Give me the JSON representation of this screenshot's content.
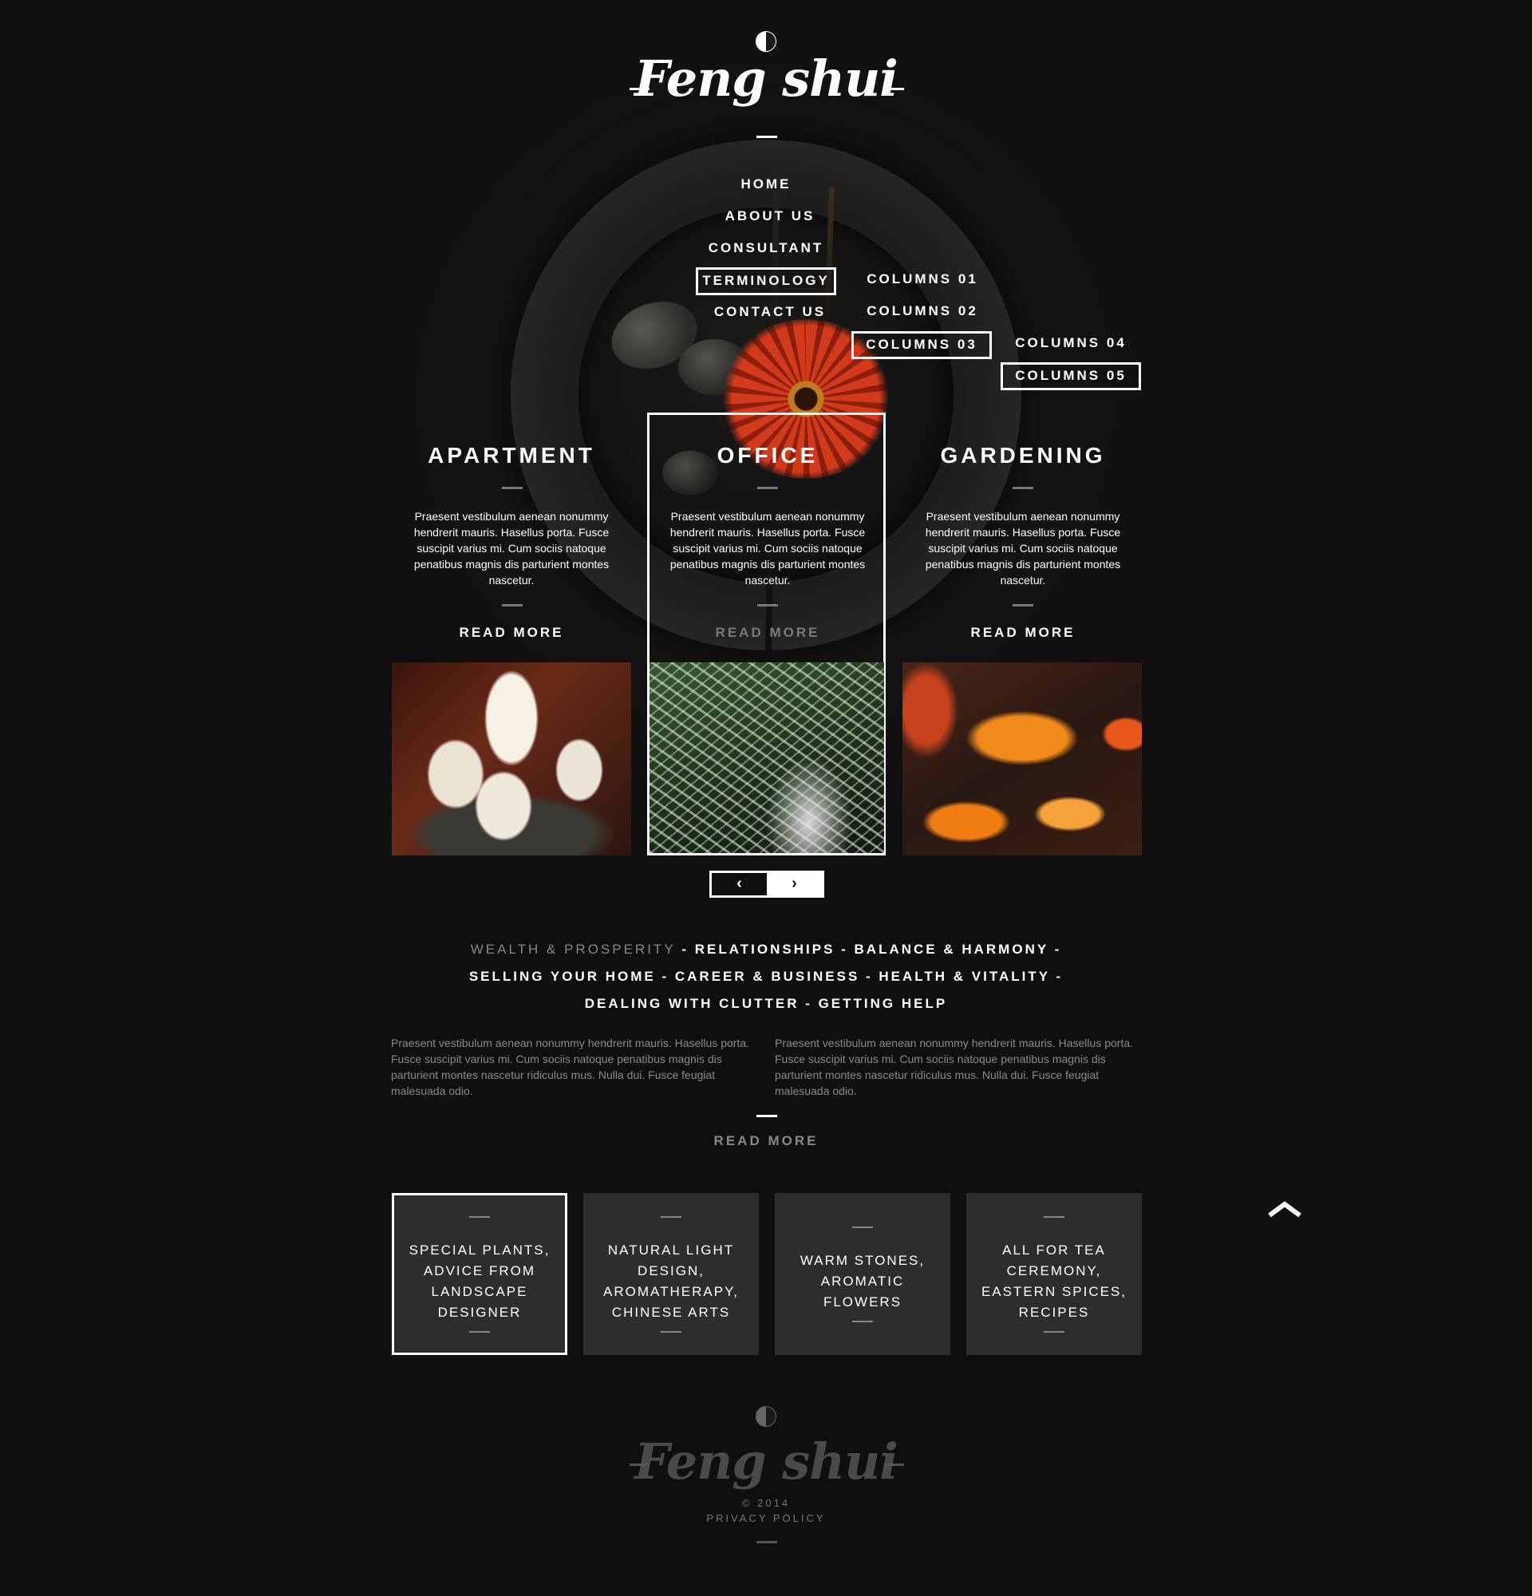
{
  "header": {
    "logo_text": "Feng shui"
  },
  "nav": {
    "items": [
      "HOME",
      "ABOUT US",
      "CONSULTANT",
      "TERMINOLOGY",
      "CONTACT US"
    ],
    "submenu": [
      "COLUMNS 01",
      "COLUMNS 02",
      "COLUMNS 03"
    ],
    "subsubmenu": [
      "COLUMNS 04",
      "COLUMNS 05"
    ]
  },
  "cards": [
    {
      "title": "APARTMENT",
      "text": "Praesent vestibulum aenean nonummy hendrerit mauris. Hasellus porta. Fusce suscipit varius mi. Cum sociis natoque penatibus magnis dis parturient montes nascetur.",
      "more": "READ MORE",
      "more_color": "#ffffff"
    },
    {
      "title": "OFFICE",
      "text": "Praesent vestibulum aenean nonummy hendrerit mauris. Hasellus porta. Fusce suscipit varius mi. Cum sociis natoque penatibus magnis dis parturient montes nascetur.",
      "more": "READ MORE",
      "more_color": "#7a7a7a"
    },
    {
      "title": "GARDENING",
      "text": "Praesent vestibulum aenean nonummy hendrerit mauris. Hasellus porta. Fusce suscipit varius mi. Cum sociis natoque penatibus magnis dis parturient montes nascetur.",
      "more": "READ MORE",
      "more_color": "#ffffff"
    }
  ],
  "pager": {
    "prev": "‹",
    "next": "›"
  },
  "topics": {
    "line1_muted": "WEALTH & PROSPERITY",
    "line1_rest": " - RELATIONSHIPS - BALANCE & HARMONY -",
    "line2": "SELLING YOUR HOME - CAREER & BUSINESS - HEALTH & VITALITY -",
    "line3": "DEALING WITH CLUTTER - GETTING HELP"
  },
  "paragraphs": [
    "Praesent vestibulum aenean nonummy hendrerit mauris. Hasellus porta. Fusce suscipit varius mi. Cum sociis natoque penatibus magnis dis parturient montes nascetur  ridiculus mus. Nulla dui. Fusce feugiat malesuada odio.",
    "Praesent vestibulum aenean nonummy hendrerit mauris. Hasellus porta. Fusce suscipit varius mi. Cum sociis natoque penatibus magnis dis parturient montes nascetur  ridiculus mus. Nulla dui. Fusce feugiat malesuada odio."
  ],
  "more_link": "READ MORE",
  "features": [
    [
      "SPECIAL PLANTS,",
      "ADVICE FROM",
      "LANDSCAPE",
      "DESIGNER"
    ],
    [
      "NATURAL LIGHT",
      "DESIGN,",
      "AROMATHERAPY,",
      "CHINESE ARTS"
    ],
    [
      "WARM STONES,",
      "AROMATIC",
      "FLOWERS"
    ],
    [
      "ALL FOR TEA",
      "CEREMONY,",
      "EASTERN SPICES,",
      "RECIPES"
    ]
  ],
  "footer": {
    "logo_text": "Feng shui",
    "copyright": "© 2014",
    "privacy": "PRIVACY POLICY"
  },
  "icons": {
    "logo": "yin-yang-icon",
    "scroll_top": "chevron-up-icon"
  },
  "colors": {
    "background": "#0f0f0f",
    "accent": "#ffffff",
    "muted": "#888888",
    "box": "#2d2d2d"
  }
}
